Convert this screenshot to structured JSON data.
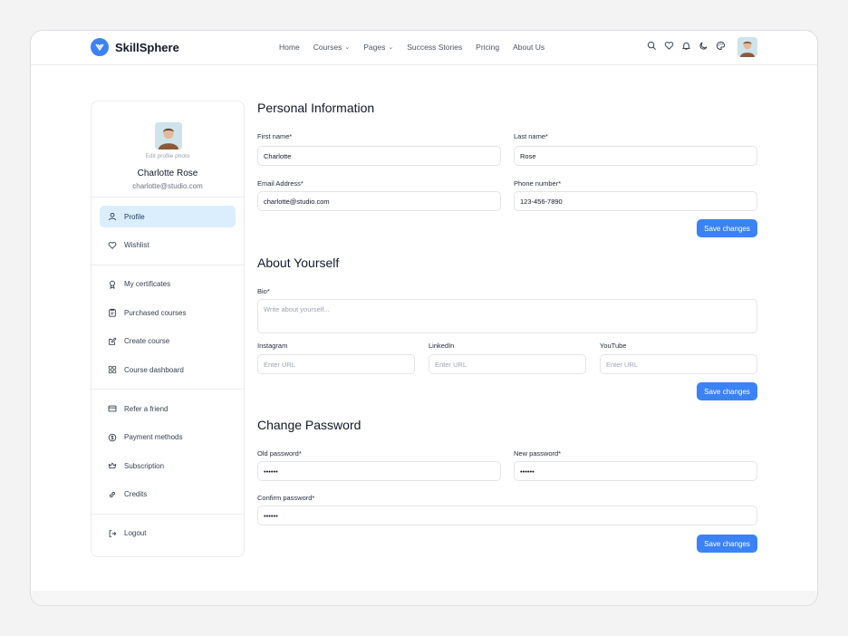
{
  "brand": {
    "name": "SkillSphere",
    "accent": "#3b82f6"
  },
  "nav": {
    "items": [
      {
        "label": "Home",
        "dropdown": false
      },
      {
        "label": "Courses",
        "dropdown": true
      },
      {
        "label": "Pages",
        "dropdown": true
      },
      {
        "label": "Success Stories",
        "dropdown": false
      },
      {
        "label": "Pricing",
        "dropdown": false
      },
      {
        "label": "About Us",
        "dropdown": false
      }
    ],
    "icons": [
      "search-icon",
      "heart-icon",
      "bell-icon",
      "moon-icon",
      "palette-icon"
    ]
  },
  "profile": {
    "edit_photo": "Edit profile photo",
    "name": "Charlotte Rose",
    "email": "charlotte@studio.com"
  },
  "sidebar": {
    "groups": [
      [
        {
          "label": "Profile",
          "icon": "user-icon",
          "active": true
        },
        {
          "label": "Wishlist",
          "icon": "heart-icon",
          "active": false
        }
      ],
      [
        {
          "label": "My certificates",
          "icon": "award-icon"
        },
        {
          "label": "Purchased courses",
          "icon": "clipboard-icon"
        },
        {
          "label": "Create course",
          "icon": "edit-icon"
        },
        {
          "label": "Course dashboard",
          "icon": "grid-icon"
        }
      ],
      [
        {
          "label": "Refer a friend",
          "icon": "card-icon"
        },
        {
          "label": "Payment methods",
          "icon": "dollar-icon"
        },
        {
          "label": "Subscription",
          "icon": "crown-icon"
        },
        {
          "label": "Credits",
          "icon": "link-icon"
        }
      ],
      [
        {
          "label": "Logout",
          "icon": "logout-icon"
        }
      ]
    ]
  },
  "personal": {
    "title": "Personal Information",
    "first_name": {
      "label": "First name*",
      "value": "Charlotte"
    },
    "last_name": {
      "label": "Last name*",
      "value": "Rose"
    },
    "email": {
      "label": "Email Address*",
      "value": "charlotte@studio.com"
    },
    "phone": {
      "label": "Phone number*",
      "value": "123-456-7890"
    },
    "save": "Save changes"
  },
  "about": {
    "title": "About Yourself",
    "bio": {
      "label": "Bio*",
      "placeholder": "Write about yourself..."
    },
    "instagram": {
      "label": "Instagram",
      "placeholder": "Enter URL"
    },
    "linkedin": {
      "label": "LinkedIn",
      "placeholder": "Enter URL"
    },
    "youtube": {
      "label": "YouTube",
      "placeholder": "Enter URL"
    },
    "save": "Save changes"
  },
  "password": {
    "title": "Change Password",
    "old": {
      "label": "Old password*",
      "value": "••••••"
    },
    "new": {
      "label": "New password*",
      "value": "••••••"
    },
    "confirm": {
      "label": "Confirm password*",
      "value": "••••••"
    },
    "save": "Save changes"
  }
}
